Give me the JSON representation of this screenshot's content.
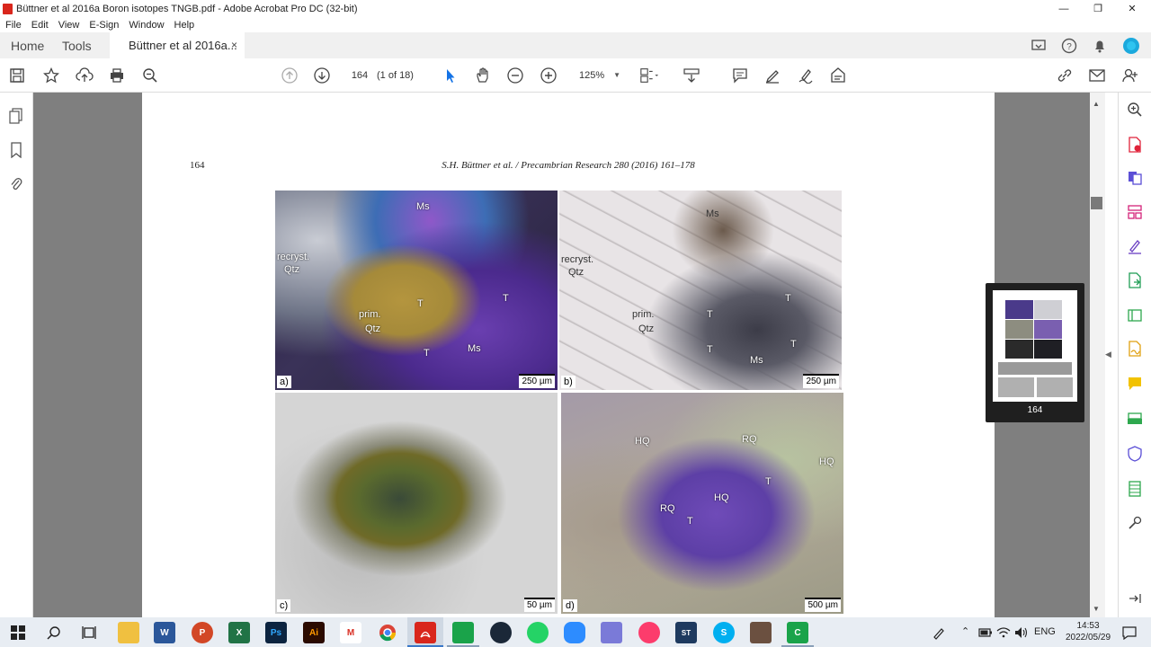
{
  "window": {
    "title": "Büttner et al 2016a Boron isotopes TNGB.pdf - Adobe Acrobat Pro DC (32-bit)",
    "minimize": "—",
    "maximize": "❐",
    "close": "✕"
  },
  "menu": [
    "File",
    "Edit",
    "View",
    "E-Sign",
    "Window",
    "Help"
  ],
  "tabs": {
    "home": "Home",
    "tools": "Tools",
    "document": "Büttner et al 2016a...",
    "close": "×"
  },
  "toolbar": {
    "page_current": "164",
    "page_of": "(1 of 18)",
    "zoom": "125%"
  },
  "document": {
    "page_number": "164",
    "running_head": "S.H. Büttner et al. / Precambrian Research 280 (2016) 161–178",
    "panels": [
      {
        "letter": "a)",
        "scale": "250 µm",
        "labels": [
          "Ms",
          "recryst.",
          "Qtz",
          "prim.",
          "Qtz",
          "T",
          "T",
          "T",
          "Ms"
        ]
      },
      {
        "letter": "b)",
        "scale": "250 µm",
        "labels": [
          "Ms",
          "recryst.",
          "Qtz",
          "prim.",
          "Qtz",
          "T",
          "T",
          "T",
          "T",
          "Ms"
        ]
      },
      {
        "letter": "c)",
        "scale": "50 µm",
        "labels": []
      },
      {
        "letter": "d)",
        "scale": "500 µm",
        "labels": [
          "HQ",
          "RQ",
          "HQ",
          "T",
          "HQ",
          "RQ",
          "T"
        ]
      }
    ]
  },
  "thumbnail": {
    "label": "164"
  },
  "taskbar": {
    "apps": [
      "start",
      "search",
      "task-view",
      "file-explorer",
      "word",
      "powerpoint",
      "excel",
      "ps",
      "ai",
      "gmail",
      "chrome",
      "acrobat",
      "camtasia",
      "steam",
      "whatsapp",
      "zoom",
      "notes",
      "itunes",
      "st",
      "skype",
      "person",
      "corel"
    ],
    "labels": {
      "word": "W",
      "powerpoint": "P",
      "excel": "X",
      "ps": "Ps",
      "ai": "Ai",
      "gmail": "M",
      "st": "ST",
      "skype": "S",
      "corel": "C"
    },
    "language": "ENG",
    "time": "14:53",
    "date": "2022/05/29"
  },
  "colors": {
    "accent": "#1473e6",
    "acrobat_red": "#d9261c",
    "viewport_gray": "#7f7f7f"
  }
}
